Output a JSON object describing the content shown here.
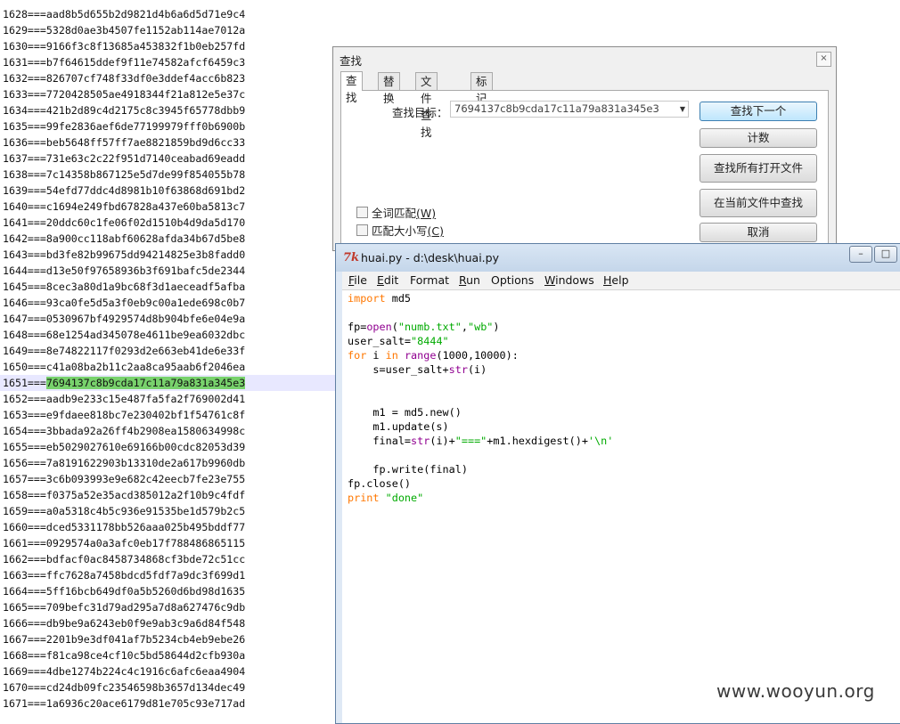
{
  "editor": {
    "lines": [
      {
        "n": "1628",
        "hash": "aad8b5d655b2d9821d4b6a6d5d71e9c4"
      },
      {
        "n": "1629",
        "hash": "5328d0ae3b4507fe1152ab114ae7012a"
      },
      {
        "n": "1630",
        "hash": "9166f3c8f13685a453832f1b0eb257fd"
      },
      {
        "n": "1631",
        "hash": "b7f64615ddef9f11e74582afcf6459c3"
      },
      {
        "n": "1632",
        "hash": "826707cf748f33df0e3ddef4acc6b823"
      },
      {
        "n": "1633",
        "hash": "7720428505ae4918344f21a812e5e37c"
      },
      {
        "n": "1634",
        "hash": "421b2d89c4d2175c8c3945f65778dbb9"
      },
      {
        "n": "1635",
        "hash": "99fe2836aef6de77199979fff0b6900b"
      },
      {
        "n": "1636",
        "hash": "beb5648ff57ff7ae8821859bd9d6cc33"
      },
      {
        "n": "1637",
        "hash": "731e63c2c22f951d7140ceabad69eadd"
      },
      {
        "n": "1638",
        "hash": "7c14358b867125e5d7de99f854055b78"
      },
      {
        "n": "1639",
        "hash": "54efd77ddc4d8981b10f63868d691bd2"
      },
      {
        "n": "1640",
        "hash": "c1694e249fbd67828a437e60ba5813c7"
      },
      {
        "n": "1641",
        "hash": "20ddc60c1fe06f02d1510b4d9da5d170"
      },
      {
        "n": "1642",
        "hash": "8a900cc118abf60628afda34b67d5be8"
      },
      {
        "n": "1643",
        "hash": "bd3fe82b99675dd94214825e3b8fadd0"
      },
      {
        "n": "1644",
        "hash": "d13e50f97658936b3f691bafc5de2344"
      },
      {
        "n": "1645",
        "hash": "8cec3a80d1a9bc68f3d1aeceadf5afba"
      },
      {
        "n": "1646",
        "hash": "93ca0fe5d5a3f0eb9c00a1ede698c0b7"
      },
      {
        "n": "1647",
        "hash": "0530967bf4929574d8b904bfe6e04e9a"
      },
      {
        "n": "1648",
        "hash": "68e1254ad345078e4611be9ea6032dbc"
      },
      {
        "n": "1649",
        "hash": "8e74822117f0293d2e663eb41de6e33f"
      },
      {
        "n": "1650",
        "hash": "c41a08ba2b11c2aa8ca95aab6f2046ea"
      },
      {
        "n": "1651",
        "hash": "7694137c8b9cda17c11a79a831a345e3",
        "current": true
      },
      {
        "n": "1652",
        "hash": "aadb9e233c15e487fa5fa2f769002d41"
      },
      {
        "n": "1653",
        "hash": "e9fdaee818bc7e230402bf1f54761c8f"
      },
      {
        "n": "1654",
        "hash": "3bbada92a26ff4b2908ea1580634998c"
      },
      {
        "n": "1655",
        "hash": "eb5029027610e69166b00cdc82053d39"
      },
      {
        "n": "1656",
        "hash": "7a8191622903b13310de2a617b9960db"
      },
      {
        "n": "1657",
        "hash": "3c6b093993e9e682c42eecb7fe23e755"
      },
      {
        "n": "1658",
        "hash": "f0375a52e35acd385012a2f10b9c4fdf"
      },
      {
        "n": "1659",
        "hash": "a0a5318c4b5c936e91535be1d579b2c5"
      },
      {
        "n": "1660",
        "hash": "dced5331178bb526aaa025b495bddf77"
      },
      {
        "n": "1661",
        "hash": "0929574a0a3afc0eb17f788486865115"
      },
      {
        "n": "1662",
        "hash": "bdfacf0ac8458734868cf3bde72c51cc"
      },
      {
        "n": "1663",
        "hash": "ffc7628a7458bdcd5fdf7a9dc3f699d1"
      },
      {
        "n": "1664",
        "hash": "5ff16bcb649df0a5b5260d6bd98d1635"
      },
      {
        "n": "1665",
        "hash": "709befc31d79ad295a7d8a627476c9db"
      },
      {
        "n": "1666",
        "hash": "db9be9a6243eb0f9e9ab3c9a6d84f548"
      },
      {
        "n": "1667",
        "hash": "2201b9e3df041af7b5234cb4eb9ebe26"
      },
      {
        "n": "1668",
        "hash": "f81ca98ce4cf10c5bd58644d2cfb930a"
      },
      {
        "n": "1669",
        "hash": "4dbe1274b224c4c1916c6afc6eaa4904"
      },
      {
        "n": "1670",
        "hash": "cd24db09fc23546598b3657d134dec49"
      },
      {
        "n": "1671",
        "hash": "1a6936c20ace6179d81e705c93e717ad"
      }
    ],
    "separator": "==="
  },
  "find_dialog": {
    "title": "查找",
    "close_label": "×",
    "tabs": [
      "查找",
      "替换",
      "文件查找",
      "标记"
    ],
    "target_label": "查找目标：",
    "target_value": "7694137c8b9cda17c11a79a831a345e3",
    "buttons": {
      "find_next": "查找下一个",
      "count": "计数",
      "find_all_open": "查找所有打开文件",
      "find_in_current": "在当前文件中查找",
      "cancel": "取消"
    },
    "options": {
      "whole_word": "全词匹配",
      "whole_word_key": "(W)",
      "match_case": "匹配大小写",
      "match_case_key": "(C)"
    }
  },
  "idle_window": {
    "icon_glyph": "7k",
    "title": "huai.py - d:\\desk\\huai.py",
    "controls": {
      "minimize": "–",
      "maximize": "□"
    },
    "menus": [
      {
        "key": "F",
        "rest": "ile"
      },
      {
        "key": "E",
        "rest": "dit"
      },
      {
        "key": "",
        "rest": "Format"
      },
      {
        "key": "R",
        "rest": "un"
      },
      {
        "key": "",
        "rest": "Options"
      },
      {
        "key": "W",
        "rest": "indows"
      },
      {
        "key": "H",
        "rest": "elp"
      }
    ]
  },
  "colors": {
    "highlight": "#78d26c",
    "current_line": "#e8e8ff",
    "keyword": "#ff7700",
    "builtin": "#900090",
    "string": "#00aa00"
  },
  "watermark": "www.wooyun.org"
}
